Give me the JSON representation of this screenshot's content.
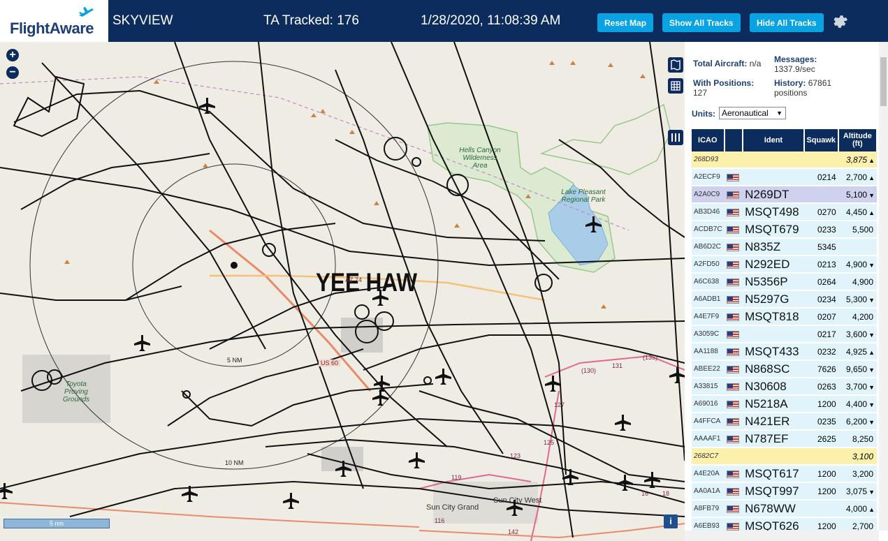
{
  "header": {
    "logo": "FlightAware",
    "app_name": "SKYVIEW",
    "tracked": "TA Tracked: 176",
    "datetime": "1/28/2020, 11:08:39 AM",
    "buttons": {
      "reset": "Reset Map",
      "show": "Show All Tracks",
      "hide": "Hide All Tracks"
    },
    "brand_color": "#0b2c5c",
    "button_color": "#08a3e3"
  },
  "map": {
    "overlay_text": "YEE HAW",
    "zoom_in": "+",
    "zoom_out": "−",
    "scale": "5 nm",
    "info": "i",
    "rings": [
      "5 NM",
      "10 NM"
    ],
    "areas": [
      "Hells Canyon Wilderness Area",
      "Lake Pleasant Regional Park",
      "Toyota Proving Grounds"
    ],
    "places": [
      "Sun City Grand",
      "Sun City West"
    ],
    "roads": [
      "AZ 74",
      "US 60",
      "(130)",
      "131",
      "(135)",
      "127",
      "125",
      "123",
      "119",
      "116",
      "142",
      "16",
      "18"
    ]
  },
  "sidebar": {
    "total_aircraft_label": "Total Aircraft:",
    "total_aircraft_value": "n/a",
    "messages_label": "Messages:",
    "messages_value": "1337.9/sec",
    "with_positions_label": "With Positions:",
    "with_positions_value": "127",
    "history_label": "History:",
    "history_value": "67861 positions",
    "units_label": "Units:",
    "units_value": "Aeronautical",
    "columns": [
      "ICAO",
      "",
      "Ident",
      "Squawk",
      "Altitude (ft)"
    ],
    "rows": [
      {
        "icao": "268D93",
        "ident": "",
        "squawk": "",
        "alt": "3,875",
        "trend": "▲",
        "style": "yellow",
        "flag": false
      },
      {
        "icao": "A2ECF9",
        "ident": "",
        "squawk": "0214",
        "alt": "2,700",
        "trend": "▲",
        "style": "light",
        "flag": true
      },
      {
        "icao": "A2A0C9",
        "ident": "N269DT",
        "squawk": "",
        "alt": "5,100",
        "trend": "▼",
        "style": "sel",
        "flag": true
      },
      {
        "icao": "AB3D46",
        "ident": "MSQT498",
        "squawk": "0270",
        "alt": "4,450",
        "trend": "▲",
        "style": "light",
        "flag": true
      },
      {
        "icao": "ACDB7C",
        "ident": "MSQT679",
        "squawk": "0233",
        "alt": "5,500",
        "trend": "",
        "style": "light",
        "flag": true
      },
      {
        "icao": "AB6D2C",
        "ident": "N835Z",
        "squawk": "5345",
        "alt": "",
        "trend": "",
        "style": "light",
        "flag": true
      },
      {
        "icao": "A2FD50",
        "ident": "N292ED",
        "squawk": "0213",
        "alt": "4,900",
        "trend": "▼",
        "style": "light",
        "flag": true
      },
      {
        "icao": "A6C638",
        "ident": "N5356P",
        "squawk": "0264",
        "alt": "4,900",
        "trend": "",
        "style": "light",
        "flag": true
      },
      {
        "icao": "A6ADB1",
        "ident": "N5297G",
        "squawk": "0234",
        "alt": "5,300",
        "trend": "▼",
        "style": "light",
        "flag": true
      },
      {
        "icao": "A4E7F9",
        "ident": "MSQT818",
        "squawk": "0207",
        "alt": "4,200",
        "trend": "",
        "style": "light",
        "flag": true
      },
      {
        "icao": "A3059C",
        "ident": "",
        "squawk": "0217",
        "alt": "3,600",
        "trend": "▼",
        "style": "light",
        "flag": true
      },
      {
        "icao": "AA1188",
        "ident": "MSQT433",
        "squawk": "0232",
        "alt": "4,925",
        "trend": "▲",
        "style": "light",
        "flag": true
      },
      {
        "icao": "ABEE22",
        "ident": "N868SC",
        "squawk": "7626",
        "alt": "9,650",
        "trend": "▼",
        "style": "light",
        "flag": true
      },
      {
        "icao": "A33815",
        "ident": "N30608",
        "squawk": "0263",
        "alt": "3,700",
        "trend": "▼",
        "style": "light",
        "flag": true
      },
      {
        "icao": "A69016",
        "ident": "N5218A",
        "squawk": "1200",
        "alt": "4,400",
        "trend": "▼",
        "style": "light",
        "flag": true
      },
      {
        "icao": "A4FFCA",
        "ident": "N421ER",
        "squawk": "0235",
        "alt": "6,200",
        "trend": "▼",
        "style": "light",
        "flag": true
      },
      {
        "icao": "AAAAF1",
        "ident": "N787EF",
        "squawk": "2625",
        "alt": "8,250",
        "trend": "",
        "style": "light",
        "flag": true
      },
      {
        "icao": "2682C7",
        "ident": "",
        "squawk": "",
        "alt": "3,100",
        "trend": "",
        "style": "yellow",
        "flag": false
      },
      {
        "icao": "A4E20A",
        "ident": "MSQT617",
        "squawk": "1200",
        "alt": "3,200",
        "trend": "",
        "style": "light",
        "flag": true
      },
      {
        "icao": "AA0A1A",
        "ident": "MSQT997",
        "squawk": "1200",
        "alt": "3,075",
        "trend": "▼",
        "style": "light",
        "flag": true
      },
      {
        "icao": "A8FB79",
        "ident": "N678WW",
        "squawk": "",
        "alt": "4,000",
        "trend": "▲",
        "style": "light",
        "flag": true
      },
      {
        "icao": "A6EB93",
        "ident": "MSQT626",
        "squawk": "1200",
        "alt": "2,700",
        "trend": "",
        "style": "light",
        "flag": true
      }
    ]
  }
}
